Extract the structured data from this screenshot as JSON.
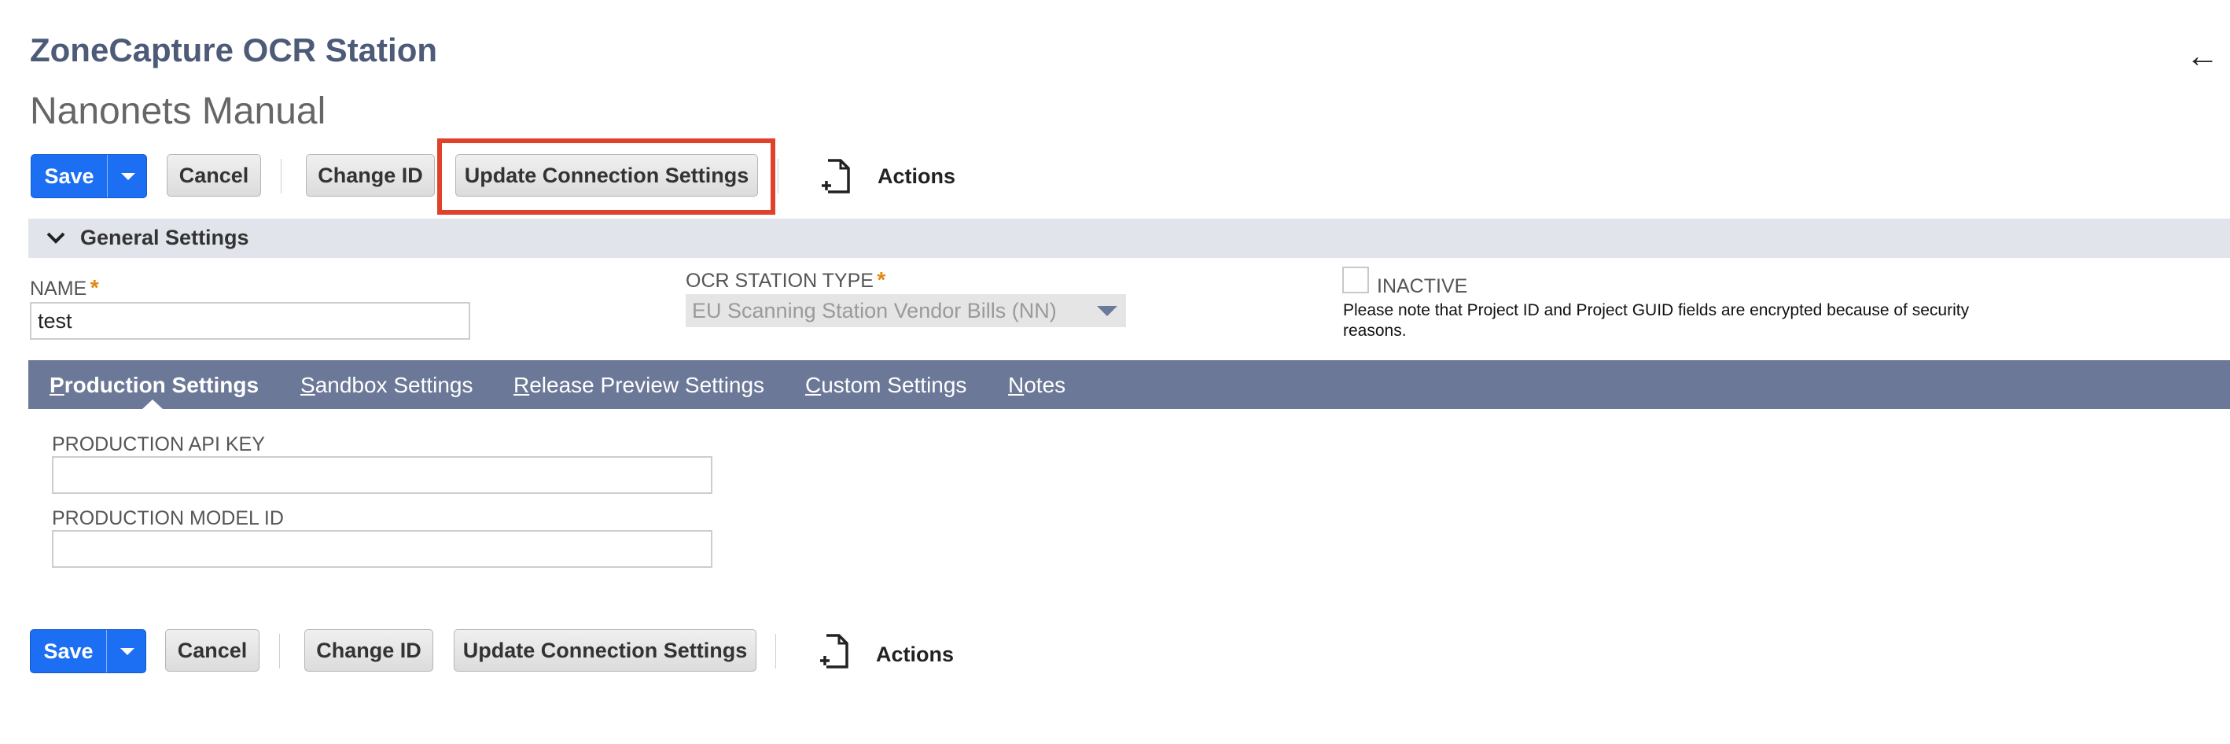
{
  "header": {
    "app_title": "ZoneCapture OCR Station",
    "record_name": "Nanonets Manual",
    "back_icon": "←"
  },
  "toolbar": {
    "save_label": "Save",
    "cancel_label": "Cancel",
    "change_id_label": "Change ID",
    "update_connection_label": "Update Connection Settings",
    "actions_label": "Actions",
    "save_color": "#1c6ef2",
    "highlight_color": "#e0412b"
  },
  "general_settings": {
    "title": "General Settings",
    "name_label": "NAME",
    "name_value": "test",
    "required_mark": "*",
    "ocr_station_type_label": "OCR STATION TYPE",
    "ocr_station_type_value": "EU Scanning Station Vendor Bills (NN)",
    "inactive_label": "INACTIVE",
    "inactive_checked": false,
    "note": "Please note that Project ID and Project GUID fields are encrypted because of security reasons."
  },
  "tabs": [
    {
      "first": "P",
      "rest": "roduction Settings",
      "active": true
    },
    {
      "first": "S",
      "rest": "andbox Settings",
      "active": false
    },
    {
      "first": "R",
      "rest": "elease Preview Settings",
      "active": false
    },
    {
      "first": "C",
      "rest": "ustom Settings",
      "active": false
    },
    {
      "first": "N",
      "rest": "otes",
      "active": false
    }
  ],
  "production": {
    "api_key_label": "PRODUCTION API KEY",
    "api_key_value": "",
    "model_id_label": "PRODUCTION MODEL ID",
    "model_id_value": ""
  },
  "colors": {
    "title": "#4d5b78",
    "section_bar": "#e1e4ea",
    "tab_bar": "#6b7897"
  }
}
